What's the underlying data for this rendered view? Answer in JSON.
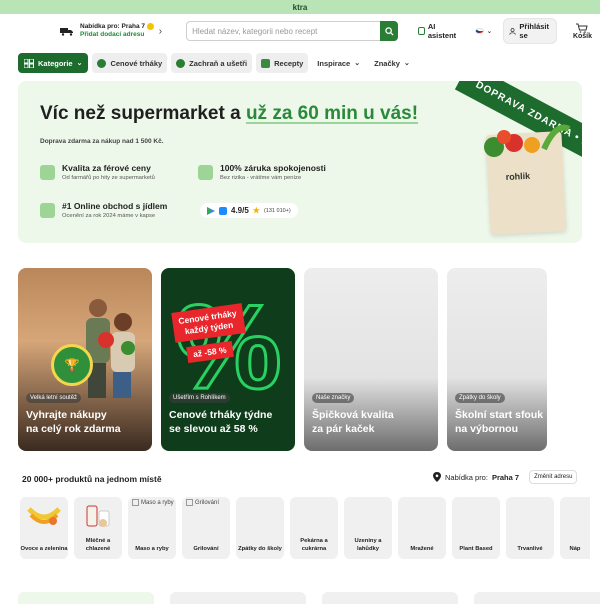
{
  "topstrip": {
    "text": "ktra"
  },
  "header": {
    "delivery_title": "Nabídka pro: Praha 7",
    "delivery_link": "Přidat dodací adresu",
    "search_placeholder": "Hledat název, kategorii nebo recept",
    "ai_label": "AI asistent",
    "login_label": "Přihlásit se",
    "cart_label": "Košík"
  },
  "nav": {
    "items": [
      {
        "label": "Kategorie"
      },
      {
        "label": "Cenové trháky"
      },
      {
        "label": "Zachraň a ušetři"
      },
      {
        "label": "Recepty"
      },
      {
        "label": "Inspirace"
      },
      {
        "label": "Značky"
      }
    ]
  },
  "hero": {
    "title_part1": "Víc než supermarket a ",
    "title_part2": "už za 60 min u vás!",
    "subtitle": "Doprava zdarma za nákup nad 1 500 Kč.",
    "features": [
      {
        "title": "Kvalita za férové ceny",
        "sub": "Od farmářů po hity ze supermarketů"
      },
      {
        "title": "100% záruka spokojenosti",
        "sub": "Bez rizika - vrátíme vám peníze"
      },
      {
        "title": "#1 Online obchod s jídlem",
        "sub": "Ocenění za rok 2024 máme v kapse"
      }
    ],
    "rating_value": "4.9/5",
    "rating_count": "(131 010+)",
    "ribbon_text": "DOPRAVA ZDARMA • DO",
    "bag_brand": "rohlik"
  },
  "promo_cards": [
    {
      "tag": "Velká letní soutěž",
      "title_l1": "Vyhrajte nákupy",
      "title_l2": "na celý rok zdarma"
    },
    {
      "tag": "Ušetřím s Rohlíkem",
      "title_l1": "Cenové trháky týdne",
      "title_l2": "se slevou až 58 %",
      "sale_l1": "Cenové trháky",
      "sale_l2": "každý týden",
      "sale_pct": "až -58 %",
      "big": "%"
    },
    {
      "tag": "Naše značky",
      "title_l1": "Špičková kvalita",
      "title_l2": "za pár kaček"
    },
    {
      "tag": "Zpátky do školy",
      "title_l1": "Školní start sfouk",
      "title_l2": "na výbornou"
    }
  ],
  "products": {
    "heading": "20 000+ produktů na jednom místě",
    "location_prefix": "Nabídka pro: ",
    "location_city": "Praha 7",
    "change_button": "Změnit adresu"
  },
  "categories": [
    {
      "label": "Ovoce a zelenina",
      "alt": ""
    },
    {
      "label": "Mléčné a chlazené",
      "alt": ""
    },
    {
      "label": "Maso a ryby",
      "alt": "Maso a ryby"
    },
    {
      "label": "Grilování",
      "alt": "Grilování"
    },
    {
      "label": "Zpátky do školy",
      "alt": ""
    },
    {
      "label": "Pekárna a cukrárna",
      "alt": ""
    },
    {
      "label": "Uzeniny a lahůdky",
      "alt": ""
    },
    {
      "label": "Mražené",
      "alt": ""
    },
    {
      "label": "Plant Based",
      "alt": ""
    },
    {
      "label": "Trvanlivé",
      "alt": ""
    },
    {
      "label": "Náp",
      "alt": ""
    }
  ]
}
